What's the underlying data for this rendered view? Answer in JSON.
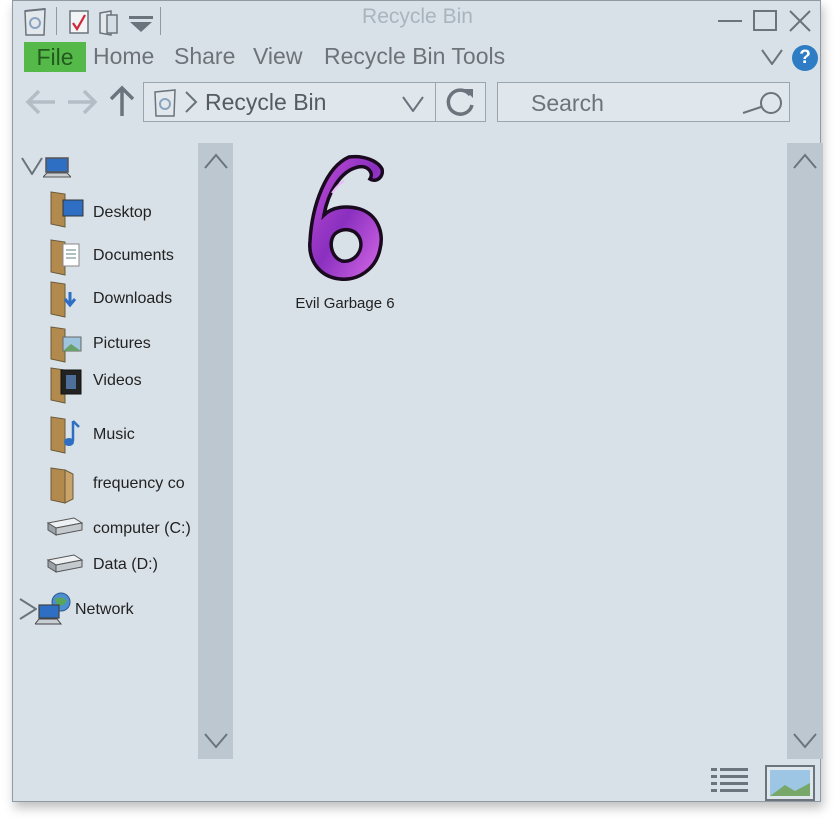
{
  "window": {
    "title": "Recycle Bin"
  },
  "ribbon": {
    "file": "File",
    "tabs": [
      {
        "label": "Home"
      },
      {
        "label": "Share"
      },
      {
        "label": "View"
      },
      {
        "label": "Recycle Bin Tools"
      }
    ],
    "help": "?"
  },
  "address": {
    "path": "Recycle Bin"
  },
  "search": {
    "placeholder": "Search"
  },
  "nav": {
    "items": [
      {
        "label": "Desktop",
        "icon": "folder-desktop-icon"
      },
      {
        "label": "Documents",
        "icon": "folder-documents-icon"
      },
      {
        "label": "Downloads",
        "icon": "folder-downloads-icon"
      },
      {
        "label": "Pictures",
        "icon": "folder-pictures-icon"
      },
      {
        "label": "Videos",
        "icon": "folder-videos-icon"
      },
      {
        "label": "Music",
        "icon": "folder-music-icon"
      },
      {
        "label": "frequency co",
        "icon": "folder-icon"
      },
      {
        "label": "computer (C:)",
        "icon": "drive-icon"
      },
      {
        "label": "Data (D:)",
        "icon": "drive-icon"
      }
    ],
    "network": "Network"
  },
  "files": [
    {
      "name": "Evil Garbage 6",
      "icon": "purple-six-icon"
    }
  ],
  "colors": {
    "file_tab": "#54b948",
    "window_bg": "#d9e1e8",
    "scrollbar": "#bcc7cf",
    "accent_blue": "#2e7cc4"
  }
}
